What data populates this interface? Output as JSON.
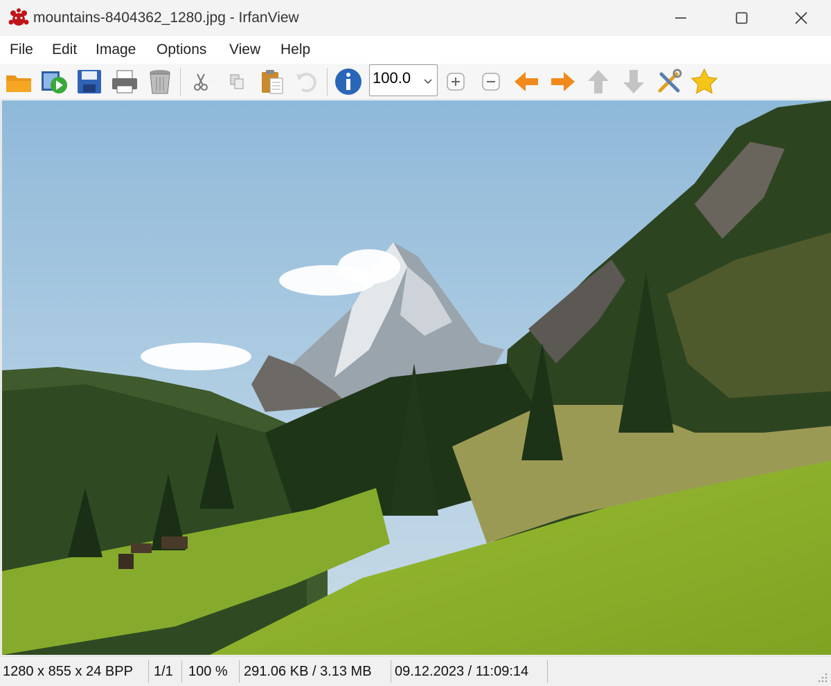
{
  "window": {
    "title": "mountains-8404362_1280.jpg - IrfanView",
    "app_icon": "irfanview-cat-icon"
  },
  "menu": {
    "items": [
      "File",
      "Edit",
      "Image",
      "Options",
      "View",
      "Help"
    ]
  },
  "toolbar": {
    "buttons": [
      {
        "name": "open-icon",
        "label": "Open"
      },
      {
        "name": "slideshow-icon",
        "label": "Slideshow"
      },
      {
        "name": "save-icon",
        "label": "Save"
      },
      {
        "name": "print-icon",
        "label": "Print"
      },
      {
        "name": "delete-icon",
        "label": "Delete"
      },
      {
        "name": "cut-icon",
        "label": "Cut"
      },
      {
        "name": "copy-icon",
        "label": "Copy"
      },
      {
        "name": "paste-icon",
        "label": "Paste"
      },
      {
        "name": "undo-icon",
        "label": "Undo"
      },
      {
        "name": "info-icon",
        "label": "Info"
      },
      {
        "name": "zoom-in-icon",
        "label": "Zoom in"
      },
      {
        "name": "zoom-out-icon",
        "label": "Zoom out"
      },
      {
        "name": "previous-icon",
        "label": "Previous"
      },
      {
        "name": "next-icon",
        "label": "Next"
      },
      {
        "name": "first-icon",
        "label": "First"
      },
      {
        "name": "last-icon",
        "label": "Last"
      },
      {
        "name": "settings-icon",
        "label": "Properties"
      },
      {
        "name": "favorite-icon",
        "label": "Favorites"
      }
    ],
    "zoom_value": "100.0"
  },
  "colors": {
    "sky": "#a9cbe2",
    "grass": "#8fb52a",
    "forest": "#2f4a22",
    "arrow_orange": "#f08a1c",
    "star_yellow": "#f5c518"
  },
  "status": {
    "dimensions": "1280 x 855 x 24 BPP",
    "page": "1/1",
    "zoom": "100 %",
    "filesize": "291.06 KB / 3.13 MB",
    "datetime": "09.12.2023 / 11:09:14"
  }
}
